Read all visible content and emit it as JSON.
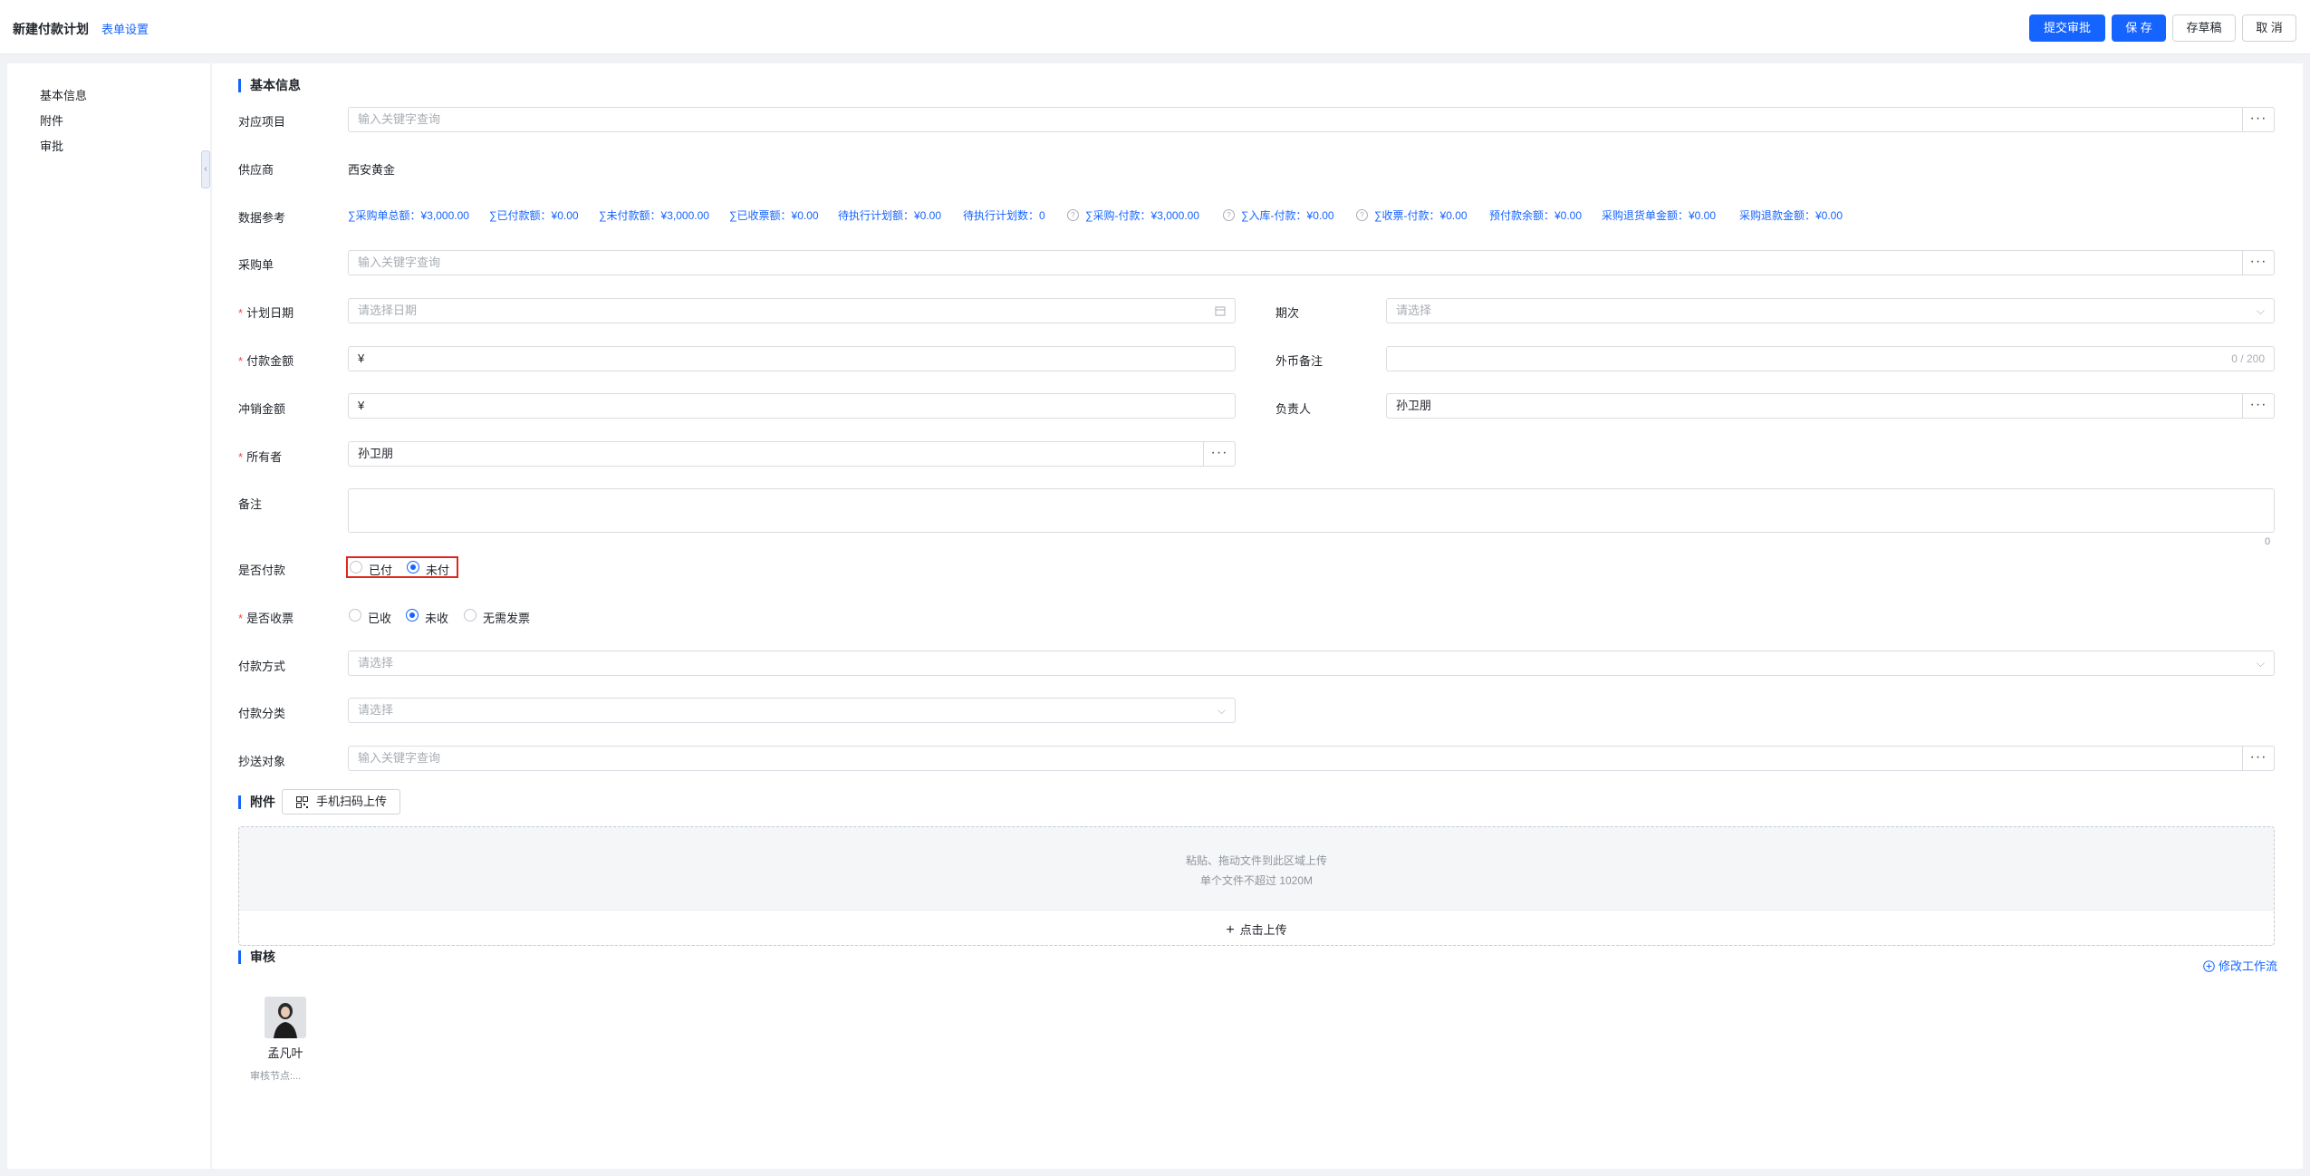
{
  "header": {
    "title": "新建付款计划",
    "form_settings": "表单设置",
    "buttons": {
      "submit": "提交审批",
      "save": "保 存",
      "draft": "存草稿",
      "cancel": "取 消"
    }
  },
  "sidebar": {
    "items": [
      "基本信息",
      "附件",
      "审批"
    ]
  },
  "basic": {
    "section_title": "基本信息",
    "project": {
      "label": "对应项目",
      "placeholder": "输入关键字查询"
    },
    "supplier": {
      "label": "供应商",
      "value": "西安黄金"
    },
    "data_ref": {
      "label": "数据参考",
      "items": [
        "∑采购单总额：¥3,000.00",
        "∑已付款额：¥0.00",
        "∑未付款额：¥3,000.00",
        "∑已收票额：¥0.00",
        "待执行计划额：¥0.00",
        "待执行计划数：0",
        "∑采购-付款：¥3,000.00",
        "∑入库-付款：¥0.00",
        "∑收票-付款：¥0.00",
        "预付款余额：¥0.00",
        "采购退货单金额：¥0.00",
        "采购退款金额：¥0.00"
      ]
    },
    "purchase_order": {
      "label": "采购单",
      "placeholder": "输入关键字查询"
    },
    "plan_date": {
      "label": "计划日期",
      "placeholder": "请选择日期"
    },
    "period": {
      "label": "期次",
      "placeholder": "请选择"
    },
    "pay_amount": {
      "label": "付款金额",
      "prefix": "¥"
    },
    "fx_note": {
      "label": "外币备注",
      "counter": "0 / 200"
    },
    "offset_amount": {
      "label": "冲销金额",
      "prefix": "¥"
    },
    "manager": {
      "label": "负责人",
      "value": "孙卫朋"
    },
    "owner": {
      "label": "所有者",
      "value": "孙卫朋"
    },
    "remark": {
      "label": "备注",
      "counter": "0"
    },
    "is_paid": {
      "label": "是否付款",
      "options": [
        "已付",
        "未付"
      ],
      "selected": "未付"
    },
    "is_invoiced": {
      "label": "是否收票",
      "options": [
        "已收",
        "未收",
        "无需发票"
      ],
      "selected": "未收"
    },
    "pay_method": {
      "label": "付款方式",
      "placeholder": "请选择"
    },
    "pay_category": {
      "label": "付款分类",
      "placeholder": "请选择"
    },
    "cc": {
      "label": "抄送对象",
      "placeholder": "输入关键字查询"
    }
  },
  "attachment": {
    "section_title": "附件",
    "scan_button": "手机扫码上传",
    "hint1": "粘贴、拖动文件到此区域上传",
    "hint2": "单个文件不超过 1020M",
    "upload_label": "点击上传"
  },
  "approval": {
    "section_title": "审核",
    "modify_workflow": "修改工作流",
    "approver_name": "孟凡叶",
    "approver_node": "审核节点:..."
  }
}
